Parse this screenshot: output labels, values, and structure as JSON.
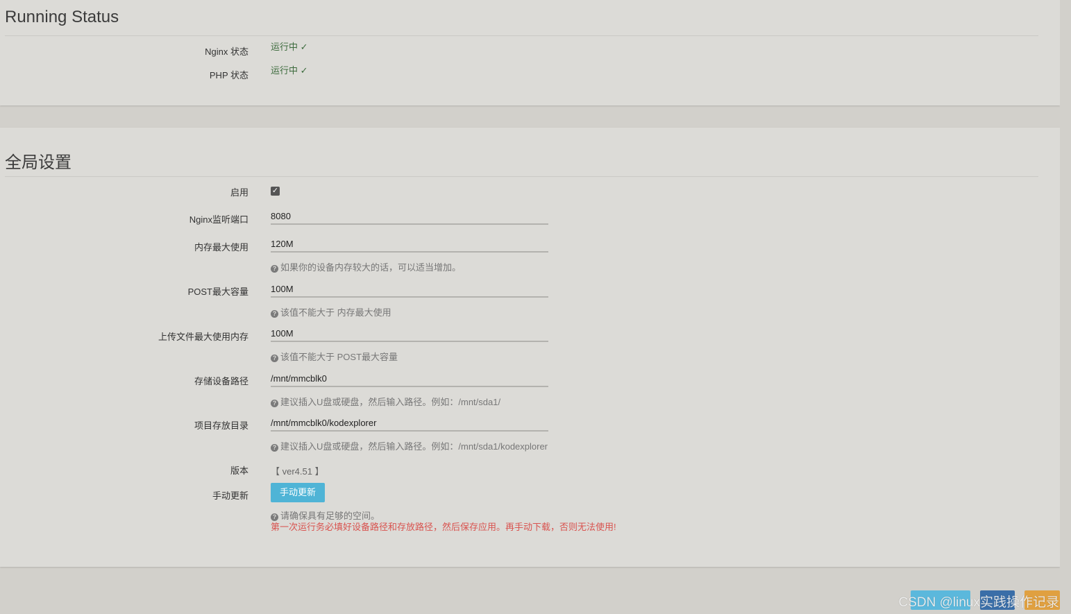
{
  "status_section": {
    "title": "Running Status",
    "rows": [
      {
        "label": "Nginx 状态",
        "value": "运行中 ✓"
      },
      {
        "label": "PHP 状态",
        "value": "运行中 ✓"
      }
    ]
  },
  "global_section": {
    "title": "全局设置",
    "enable": {
      "label": "启用",
      "checked": true
    },
    "nginx_port": {
      "label": "Nginx监听端口",
      "value": "8080"
    },
    "memory_max": {
      "label": "内存最大使用",
      "value": "120M",
      "help": "如果你的设备内存较大的话，可以适当增加。"
    },
    "post_max": {
      "label": "POST最大容量",
      "value": "100M",
      "help": "该值不能大于 内存最大使用"
    },
    "upload_max": {
      "label": "上传文件最大使用内存",
      "value": "100M",
      "help": "该值不能大于 POST最大容量"
    },
    "storage_path": {
      "label": "存储设备路径",
      "value": "/mnt/mmcblk0",
      "help": "建议插入U盘或硬盘，然后输入路径。例如：/mnt/sda1/"
    },
    "project_dir": {
      "label": "项目存放目录",
      "value": "/mnt/mmcblk0/kodexplorer",
      "help": "建议插入U盘或硬盘，然后输入路径。例如：/mnt/sda1/kodexplorer"
    },
    "version": {
      "label": "版本",
      "value": "【 ver4.51 】"
    },
    "manual_update": {
      "label": "手动更新",
      "button": "手动更新",
      "help": "请确保具有足够的空间。",
      "warning": "第一次运行务必填好设备路径和存放路径，然后保存应用。再手动下载，否则无法使用!"
    }
  },
  "footer": {
    "watermark": "CSDN @linux实践操作记录"
  },
  "colors": {
    "accent_button": "#4fb4d6",
    "warning_text": "#d9534f",
    "panel_bg": "#dcdbd7"
  }
}
